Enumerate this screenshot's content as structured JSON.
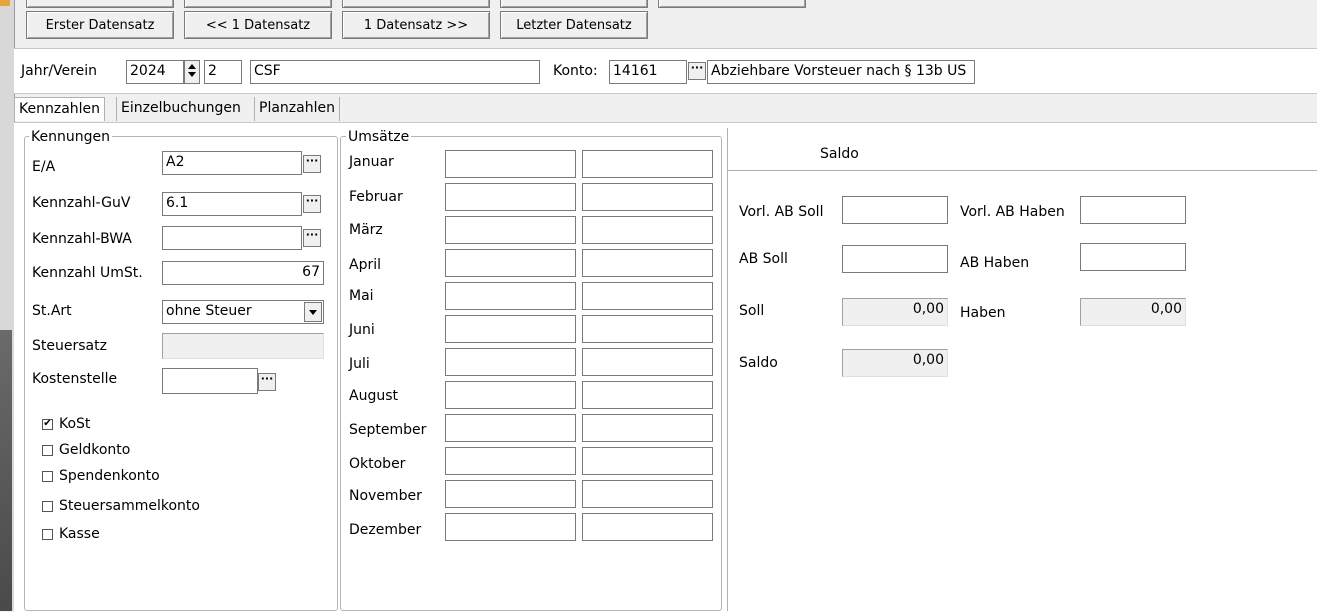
{
  "toolbar": {
    "first_record": "Erster Datensatz",
    "prev_record": "<< 1 Datensatz",
    "next_record": "1 Datensatz >>",
    "last_record": "Letzter Datensatz"
  },
  "header": {
    "year_club_label": "Jahr/Verein",
    "year_value": "2024",
    "club_no": "2",
    "club_name": "CSF",
    "account_label": "Konto:",
    "account_no": "14161",
    "account_desc": "Abziehbare Vorsteuer nach § 13b US"
  },
  "tabs": [
    {
      "label": "Kennzahlen",
      "active": true
    },
    {
      "label": "Einzelbuchungen"
    },
    {
      "label": "Planzahlen"
    }
  ],
  "kennungen": {
    "title": "Kennungen",
    "ea_label": "E/A",
    "ea_value": "A2",
    "guv_label": "Kennzahl-GuV",
    "guv_value": "6.1",
    "bwa_label": "Kennzahl-BWA",
    "bwa_value": "",
    "ust_label": "Kennzahl UmSt.",
    "ust_value": "67",
    "stArt_label": "St.Art",
    "stArt_value": "ohne Steuer",
    "steuersatz_label": "Steuersatz",
    "steuersatz_value": "",
    "kostenstelle_label": "Kostenstelle",
    "kostenstelle_value": "",
    "checkboxes": [
      {
        "label": "KoSt",
        "checked": true
      },
      {
        "label": "Geldkonto",
        "checked": false
      },
      {
        "label": "Spendenkonto",
        "checked": false
      },
      {
        "label": "Steuersammelkonto",
        "checked": false
      },
      {
        "label": "Kasse",
        "checked": false
      }
    ]
  },
  "umsaetze": {
    "title": "Umsätze",
    "months": [
      "Januar",
      "Februar",
      "März",
      "April",
      "Mai",
      "Juni",
      "Juli",
      "August",
      "September",
      "Oktober",
      "November",
      "Dezember"
    ]
  },
  "saldo": {
    "header": "Saldo",
    "vorl_ab_soll_label": "Vorl. AB Soll",
    "vorl_ab_soll_value": "",
    "vorl_ab_haben_label": "Vorl. AB Haben",
    "vorl_ab_haben_value": "",
    "ab_soll_label": "AB Soll",
    "ab_soll_value": "",
    "ab_haben_label": "AB Haben",
    "ab_haben_value": "",
    "soll_label": "Soll",
    "soll_value": "0,00",
    "haben_label": "Haben",
    "haben_value": "0,00",
    "saldo_label": "Saldo",
    "saldo_value": "0,00"
  }
}
